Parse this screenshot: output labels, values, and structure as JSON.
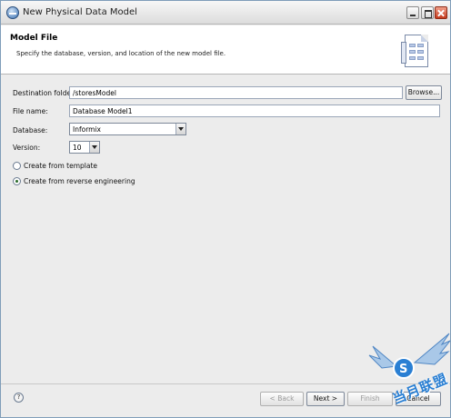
{
  "window": {
    "title": "New Physical Data Model"
  },
  "banner": {
    "title": "Model File",
    "description": "Specify the database, version, and location of the new model file."
  },
  "form": {
    "destination_folder_label": "Destination folder:",
    "destination_folder_value": "/storesModel",
    "browse_label": "Browse...",
    "file_name_label": "File name:",
    "file_name_value": "Database Model1",
    "database_label": "Database:",
    "database_value": "Informix",
    "version_label": "Version:",
    "version_value": "10",
    "options": [
      {
        "label": "Create from template",
        "checked": false
      },
      {
        "label": "Create from reverse engineering",
        "checked": true
      }
    ]
  },
  "footer": {
    "back_label": "< Back",
    "next_label": "Next >",
    "finish_label": "Finish",
    "cancel_label": "Cancel",
    "help_glyph": "?"
  },
  "watermark": {
    "text": "当月联盟",
    "icon": "winged-s-logo-icon"
  }
}
